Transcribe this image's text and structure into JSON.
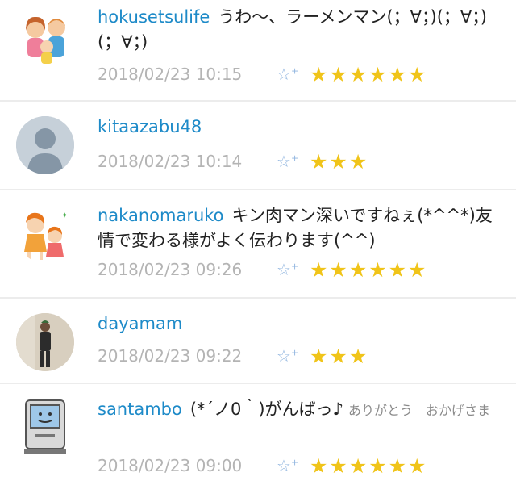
{
  "comments": [
    {
      "username": "hokusetsulife",
      "text": "うわ〜、ラーメンマン(；∀；)(；∀；)(；∀；)",
      "note": "",
      "timestamp": "2018/02/23 10:15",
      "stars": "★★★★★★",
      "avatar": "family-illustration-avatar"
    },
    {
      "username": "kitaazabu48",
      "text": "",
      "note": "",
      "timestamp": "2018/02/23 10:14",
      "stars": "★★★",
      "avatar": "default-user-avatar"
    },
    {
      "username": "nakanomaruko",
      "text": "キン肉マン深いですねぇ(*^^*)友情で変わる様がよく伝わります(^^)",
      "note": "",
      "timestamp": "2018/02/23 09:26",
      "stars": "★★★★★★",
      "avatar": "girls-illustration-avatar"
    },
    {
      "username": "dayamam",
      "text": "",
      "note": "",
      "timestamp": "2018/02/23 09:22",
      "stars": "★★★",
      "avatar": "person-photo-avatar"
    },
    {
      "username": "santambo",
      "text": "(*´ノ0｀)がんばっ♪",
      "note": "ありがとう　おかげさま",
      "timestamp": "2018/02/23 09:00",
      "stars": "★★★★★★",
      "avatar": "retro-computer-avatar"
    }
  ],
  "ui": {
    "star_add_icon": "☆",
    "star_add_plus": "+",
    "star_color": "#f0c419",
    "username_color": "#1d8ac8"
  }
}
